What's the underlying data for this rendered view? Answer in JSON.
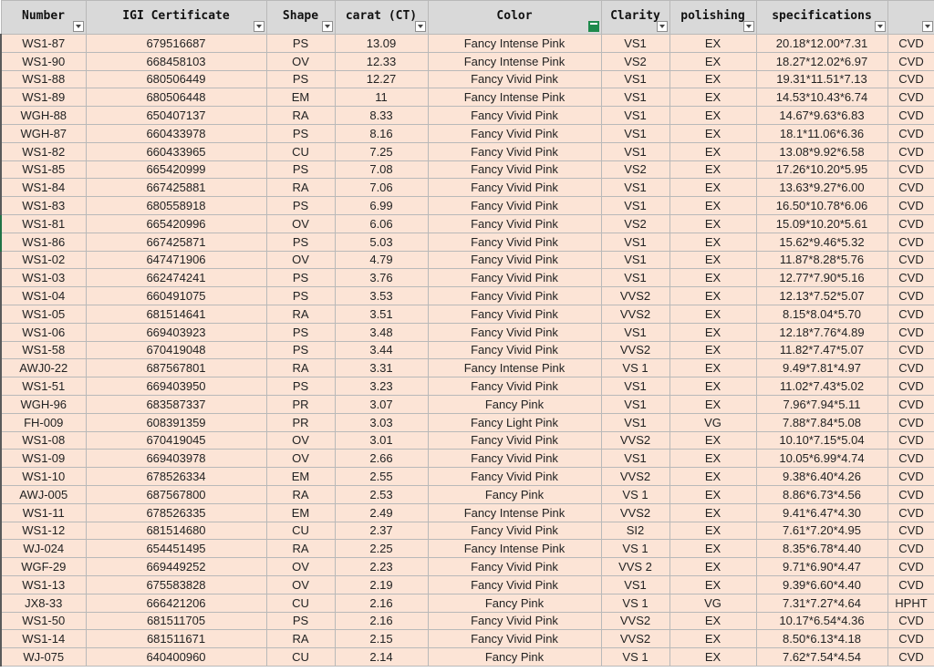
{
  "columns": [
    {
      "label": "Number",
      "filter": "dropdown"
    },
    {
      "label": "IGI Certificate",
      "filter": "dropdown"
    },
    {
      "label": "Shape",
      "filter": "dropdown"
    },
    {
      "label": "carat (CT)",
      "filter": "dropdown"
    },
    {
      "label": "Color",
      "filter": "active"
    },
    {
      "label": "Clarity",
      "filter": "dropdown"
    },
    {
      "label": "polishing",
      "filter": "dropdown"
    },
    {
      "label": "specifications",
      "filter": "dropdown"
    },
    {
      "label": "",
      "filter": "dropdown"
    }
  ],
  "rows": [
    [
      "WS1-87",
      "679516687",
      "PS",
      "13.09",
      "Fancy Intense Pink",
      "VS1",
      "EX",
      "20.18*12.00*7.31",
      "CVD"
    ],
    [
      "WS1-90",
      "668458103",
      "OV",
      "12.33",
      "Fancy Intense Pink",
      "VS2",
      "EX",
      "18.27*12.02*6.97",
      "CVD"
    ],
    [
      "WS1-88",
      "680506449",
      "PS",
      "12.27",
      "Fancy Vivid Pink",
      "VS1",
      "EX",
      "19.31*11.51*7.13",
      "CVD"
    ],
    [
      "WS1-89",
      "680506448",
      "EM",
      "11",
      "Fancy Intense Pink",
      "VS1",
      "EX",
      "14.53*10.43*6.74",
      "CVD"
    ],
    [
      "WGH-88",
      "650407137",
      "RA",
      "8.33",
      "Fancy Vivid Pink",
      "VS1",
      "EX",
      "14.67*9.63*6.83",
      "CVD"
    ],
    [
      "WGH-87",
      "660433978",
      "PS",
      "8.16",
      "Fancy Vivid Pink",
      "VS1",
      "EX",
      "18.1*11.06*6.36",
      "CVD"
    ],
    [
      "WS1-82",
      "660433965",
      "CU",
      "7.25",
      "Fancy Vivid Pink",
      "VS1",
      "EX",
      "13.08*9.92*6.58",
      "CVD"
    ],
    [
      "WS1-85",
      "665420999",
      "PS",
      "7.08",
      "Fancy Vivid Pink",
      "VS2",
      "EX",
      "17.26*10.20*5.95",
      "CVD"
    ],
    [
      "WS1-84",
      "667425881",
      "RA",
      "7.06",
      "Fancy Vivid Pink",
      "VS1",
      "EX",
      "13.63*9.27*6.00",
      "CVD"
    ],
    [
      "WS1-83",
      "680558918",
      "PS",
      "6.99",
      "Fancy Vivid Pink",
      "VS1",
      "EX",
      "16.50*10.78*6.06",
      "CVD"
    ],
    [
      "WS1-81",
      "665420996",
      "OV",
      "6.06",
      "Fancy Vivid Pink",
      "VS2",
      "EX",
      "15.09*10.20*5.61",
      "CVD"
    ],
    [
      "WS1-86",
      "667425871",
      "PS",
      "5.03",
      "Fancy Vivid Pink",
      "VS1",
      "EX",
      "15.62*9.46*5.32",
      "CVD"
    ],
    [
      "WS1-02",
      "647471906",
      "OV",
      "4.79",
      "Fancy Vivid Pink",
      "VS1",
      "EX",
      "11.87*8.28*5.76",
      "CVD"
    ],
    [
      "WS1-03",
      "662474241",
      "PS",
      "3.76",
      "Fancy Vivid Pink",
      "VS1",
      "EX",
      "12.77*7.90*5.16",
      "CVD"
    ],
    [
      "WS1-04",
      "660491075",
      "PS",
      "3.53",
      "Fancy Vivid Pink",
      "VVS2",
      "EX",
      "12.13*7.52*5.07",
      "CVD"
    ],
    [
      "WS1-05",
      "681514641",
      "RA",
      "3.51",
      "Fancy Vivid Pink",
      "VVS2",
      "EX",
      "8.15*8.04*5.70",
      "CVD"
    ],
    [
      "WS1-06",
      "669403923",
      "PS",
      "3.48",
      "Fancy Vivid Pink",
      "VS1",
      "EX",
      "12.18*7.76*4.89",
      "CVD"
    ],
    [
      "WS1-58",
      "670419048",
      "PS",
      "3.44",
      "Fancy Vivid Pink",
      "VVS2",
      "EX",
      "11.82*7.47*5.07",
      "CVD"
    ],
    [
      "AWJ0-22",
      "687567801",
      "RA",
      "3.31",
      "Fancy Intense Pink",
      "VS 1",
      "EX",
      "9.49*7.81*4.97",
      "CVD"
    ],
    [
      "WS1-51",
      "669403950",
      "PS",
      "3.23",
      "Fancy Vivid Pink",
      "VS1",
      "EX",
      "11.02*7.43*5.02",
      "CVD"
    ],
    [
      "WGH-96",
      "683587337",
      "PR",
      "3.07",
      "Fancy  Pink",
      "VS1",
      "EX",
      "7.96*7.94*5.11",
      "CVD"
    ],
    [
      "FH-009",
      "608391359",
      "PR",
      "3.03",
      "Fancy Light Pink",
      "VS1",
      "VG",
      "7.88*7.84*5.08",
      "CVD"
    ],
    [
      "WS1-08",
      "670419045",
      "OV",
      "3.01",
      "Fancy Vivid Pink",
      "VVS2",
      "EX",
      "10.10*7.15*5.04",
      "CVD"
    ],
    [
      "WS1-09",
      "669403978",
      "OV",
      "2.66",
      "Fancy Vivid Pink",
      "VS1",
      "EX",
      "10.05*6.99*4.74",
      "CVD"
    ],
    [
      "WS1-10",
      "678526334",
      "EM",
      "2.55",
      "Fancy Vivid Pink",
      "VVS2",
      "EX",
      "9.38*6.40*4.26",
      "CVD"
    ],
    [
      "AWJ-005",
      "687567800",
      "RA",
      "2.53",
      "Fancy Pink",
      "VS 1",
      "EX",
      "8.86*6.73*4.56",
      "CVD"
    ],
    [
      "WS1-11",
      "678526335",
      "EM",
      "2.49",
      "Fancy Intense Pink",
      "VVS2",
      "EX",
      "9.41*6.47*4.30",
      "CVD"
    ],
    [
      "WS1-12",
      "681514680",
      "CU",
      "2.37",
      "Fancy Vivid Pink",
      "SI2",
      "EX",
      "7.61*7.20*4.95",
      "CVD"
    ],
    [
      "WJ-024",
      "654451495",
      "RA",
      "2.25",
      "Fancy Intense Pink",
      "VS 1",
      "EX",
      "8.35*6.78*4.40",
      "CVD"
    ],
    [
      "WGF-29",
      "669449252",
      "OV",
      "2.23",
      "Fancy Vivid Pink",
      "VVS 2",
      "EX",
      "9.71*6.90*4.47",
      "CVD"
    ],
    [
      "WS1-13",
      "675583828",
      "OV",
      "2.19",
      "Fancy Vivid Pink",
      "VS1",
      "EX",
      "9.39*6.60*4.40",
      "CVD"
    ],
    [
      "JX8-33",
      "666421206",
      "CU",
      "2.16",
      "Fancy Pink",
      "VS 1",
      "VG",
      "7.31*7.27*4.64",
      "HPHT"
    ],
    [
      "WS1-50",
      "681511705",
      "PS",
      "2.16",
      "Fancy Vivid Pink",
      "VVS2",
      "EX",
      "10.17*6.54*4.36",
      "CVD"
    ],
    [
      "WS1-14",
      "681511671",
      "RA",
      "2.15",
      "Fancy Vivid Pink",
      "VVS2",
      "EX",
      "8.50*6.13*4.18",
      "CVD"
    ],
    [
      "WJ-075",
      "640400960",
      "CU",
      "2.14",
      "Fancy Pink",
      "VS 1",
      "EX",
      "7.62*7.54*4.54",
      "CVD"
    ]
  ],
  "colors": {
    "header_bg": "#d9d9d9",
    "row_bg": "#fce4d6",
    "filter_active": "#1e8a4c"
  }
}
